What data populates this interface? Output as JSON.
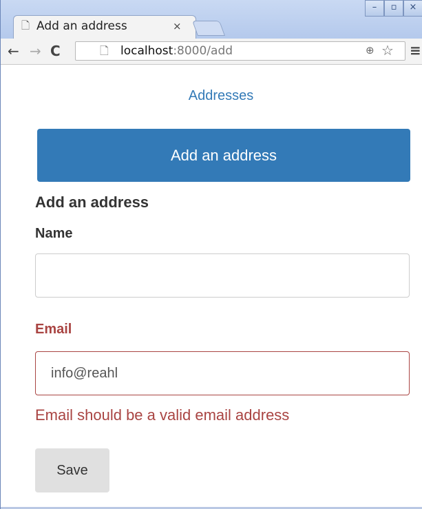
{
  "browser": {
    "tab_title": "Add an address",
    "tab_close": "×",
    "url_host": "localhost",
    "url_path": ":8000/add",
    "window_buttons": [
      "–",
      "▫",
      "×"
    ]
  },
  "page": {
    "nav_link": "Addresses",
    "jumbotron": "Add an address",
    "form_heading": "Add an address",
    "name_label": "Name",
    "name_value": "",
    "email_label": "Email",
    "email_value": "info@reahl",
    "email_error": "Email should be a valid email address",
    "save_label": "Save"
  },
  "colors": {
    "primary": "#337ab7",
    "error": "#a94442",
    "button_bg": "#e0e0e0"
  }
}
